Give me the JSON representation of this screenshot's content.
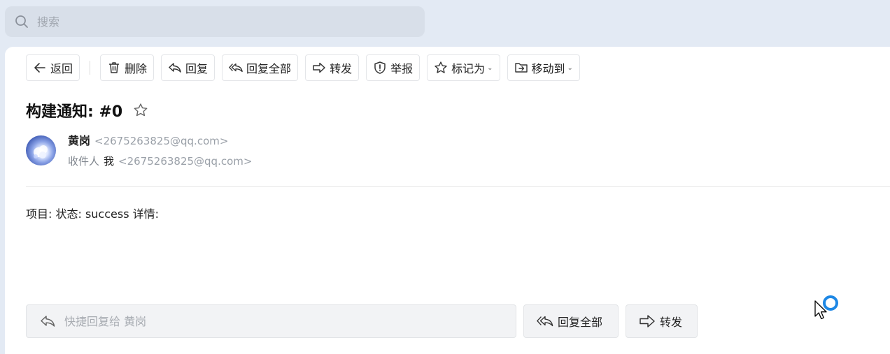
{
  "search": {
    "placeholder": "搜索",
    "icon": "search-icon"
  },
  "toolbar": {
    "back": "返回",
    "delete": "删除",
    "reply": "回复",
    "reply_all": "回复全部",
    "forward": "转发",
    "report": "举报",
    "mark_as": "标记为",
    "move_to": "移动到"
  },
  "email": {
    "subject": "构建通知: #0",
    "sender_name": "黄岗",
    "sender_addr": "<2675263825@qq.com>",
    "recipient_label": "收件人",
    "recipient_name": "我",
    "recipient_addr": "<2675263825@qq.com>",
    "body": "项目: 状态: success 详情:"
  },
  "quick_reply": {
    "placeholder": "快捷回复给 黄岗",
    "reply_all": "回复全部",
    "forward": "转发"
  },
  "colors": {
    "page_bg": "#e3eaf4",
    "loader": "#1e88e5"
  }
}
